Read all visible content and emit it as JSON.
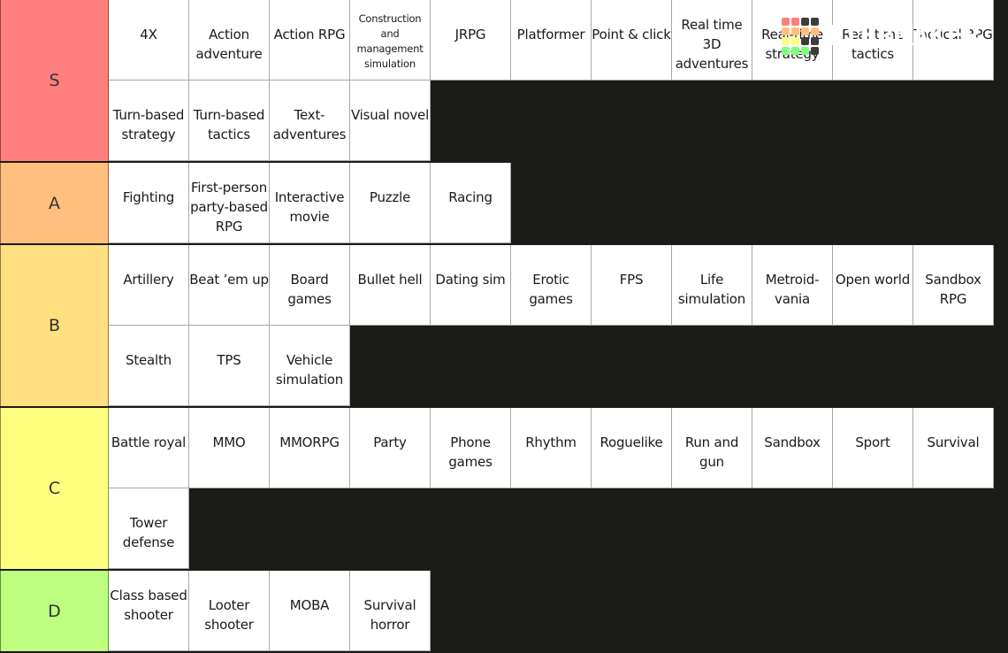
{
  "logo": {
    "text": "TiERMAKER",
    "grid_colors": [
      "#ff7f7f",
      "#ff7f7f",
      "#3c3c3c",
      "#3c3c3c",
      "#ffbf7f",
      "#ffbf7f",
      "#ffbf7f",
      "#ffbf7f",
      "#ffff7f",
      "#ffff7f",
      "#3c3c3c",
      "#3c3c3c",
      "#7fff7f",
      "#7fff7f",
      "#7fff7f",
      "#3c3c3c"
    ]
  },
  "tiers": [
    {
      "label": "S",
      "color": "#ff7f7f",
      "items": [
        "4X",
        "Action adventure",
        "Action RPG",
        "Construction and management simulation",
        "JRPG",
        "Platformer",
        "Point & click",
        "Real time 3D adventures",
        "Real-time strategy",
        "Real-time tactics",
        "Tactical RPG",
        "Turn-based strategy",
        "Turn-based tactics",
        "Text-adventures",
        "Visual novel"
      ]
    },
    {
      "label": "A",
      "color": "#ffbf7f",
      "items": [
        "Fighting",
        "First-person party-based RPG",
        "Interactive movie",
        "Puzzle",
        "Racing"
      ]
    },
    {
      "label": "B",
      "color": "#ffdf7f",
      "items": [
        "Artillery",
        "Beat ’em up",
        "Board games",
        "Bullet hell",
        "Dating sim",
        "Erotic games",
        "FPS",
        "Life simulation",
        "Metroid-vania",
        "Open world",
        "Sandbox RPG",
        "Stealth",
        "TPS",
        "Vehicle simulation"
      ]
    },
    {
      "label": "C",
      "color": "#ffff7f",
      "items": [
        "Battle royal",
        "MMO",
        "MMORPG",
        "Party",
        "Phone games",
        "Rhythm",
        "Roguelike",
        "Run and gun",
        "Sandbox",
        "Sport",
        "Survival",
        "Tower defense"
      ]
    },
    {
      "label": "D",
      "color": "#bfff7f",
      "items": [
        "Class based shooter",
        "Looter shooter",
        "MOBA",
        "Survival horror"
      ]
    }
  ]
}
